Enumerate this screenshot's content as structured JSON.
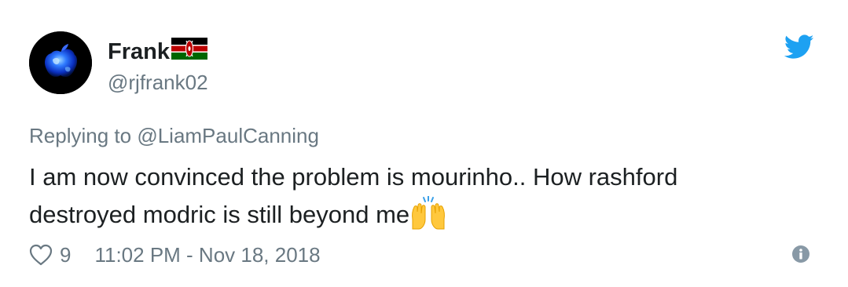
{
  "author": {
    "display_name": "Frank",
    "handle": "@rjfrank02",
    "flag_icon": "kenya-flag-icon",
    "avatar_icon": "blue-glossy-apple-avatar"
  },
  "reply": {
    "prefix": "Replying to ",
    "mention": "@LiamPaulCanning"
  },
  "tweet": {
    "line1": "I am now convinced the problem is mourinho.. How rashford",
    "line2": "destroyed modric is still beyond me",
    "emoji_icon": "raising-hands-emoji"
  },
  "footer": {
    "like_icon": "heart-outline-icon",
    "like_count": "9",
    "timestamp": "11:02 PM - Nov 18, 2018",
    "info_icon": "info-icon"
  },
  "brand": {
    "logo_icon": "twitter-bird-icon",
    "accent": "#1da1f2",
    "muted": "#697882",
    "text": "#1c2022"
  }
}
